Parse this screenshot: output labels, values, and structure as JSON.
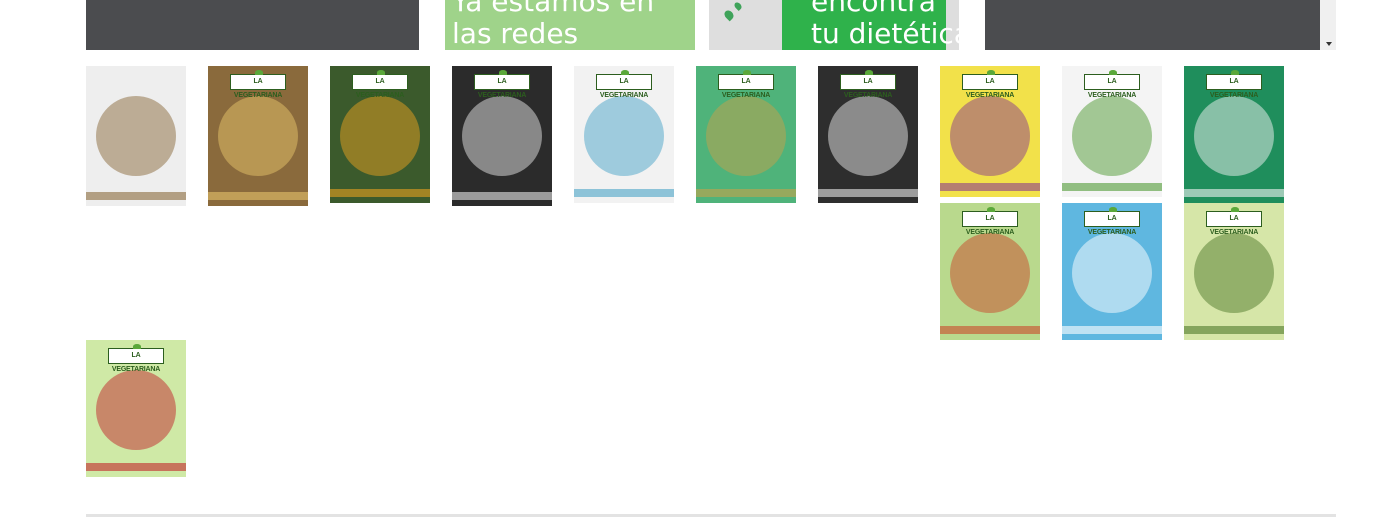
{
  "banners": [
    {
      "name": "banner-left-dark",
      "text": "",
      "color": "#4b4c4f"
    },
    {
      "name": "banner-redes",
      "text": "Ya estamos en\nlas redes",
      "color": "#9fd38a"
    },
    {
      "name": "banner-dietetica",
      "text": "encontrá\ntu dietética",
      "color": "#2fb24b"
    },
    {
      "name": "banner-right-dark",
      "text": "",
      "color": "#4b4c4f"
    }
  ],
  "brand_label": "LA VEGETARIANA",
  "thumbnails": [
    {
      "name": "magazine-cover-pan",
      "bg": "#eeeeee",
      "accent": "#8a6a3c",
      "logo": false
    },
    {
      "name": "magazine-cover-avena",
      "bg": "#8a6a3c",
      "accent": "#e6c36a",
      "logo": true
    },
    {
      "name": "magazine-cover-antioxidantes",
      "bg": "#3b5a2c",
      "accent": "#e8a020",
      "logo": true
    },
    {
      "name": "magazine-cover-espirulina",
      "bg": "#2b2b2b",
      "accent": "#e6e6e6",
      "logo": true
    },
    {
      "name": "magazine-cover-nutraceuticos",
      "bg": "#f2f2f2",
      "accent": "#4aa3c7",
      "logo": true
    },
    {
      "name": "magazine-cover-semillas",
      "bg": "#4fb37a",
      "accent": "#c6a24a",
      "logo": true
    },
    {
      "name": "magazine-cover-leches-vegetales",
      "bg": "#2e2e2e",
      "accent": "#e8e8e8",
      "logo": true
    },
    {
      "name": "magazine-cover-bueno-y-barato",
      "bg": "#f2e14a",
      "accent": "#8a3c8c",
      "logo": true
    },
    {
      "name": "magazine-cover-vegetales",
      "bg": "#f4f4f4",
      "accent": "#4f9a33",
      "logo": true
    },
    {
      "name": "magazine-cover-economias-solidarias",
      "bg": "#1f8e5c",
      "accent": "#f2f2f2",
      "logo": true
    },
    {
      "name": "magazine-cover-saludable",
      "bg": "#b9d98d",
      "accent": "#c94a2c",
      "logo": true
    },
    {
      "name": "magazine-cover-agua",
      "bg": "#5fb7e0",
      "accent": "#ffffff",
      "logo": true
    },
    {
      "name": "magazine-cover-verde",
      "bg": "#d6e6a8",
      "accent": "#4f7a2c",
      "logo": true
    },
    {
      "name": "magazine-cover-techos-verdes",
      "bg": "#cfe9a6",
      "accent": "#c2262c",
      "logo": true
    }
  ]
}
